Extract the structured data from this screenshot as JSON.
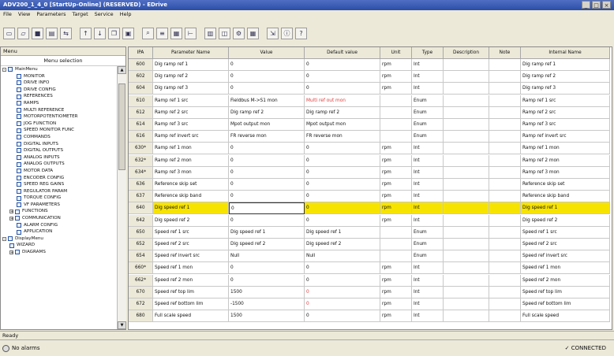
{
  "window": {
    "title": "ADV200_1_4_0 [StartUp-Online] (RESERVED) - EDrive",
    "controls": [
      "_",
      "□",
      "×"
    ]
  },
  "menubar": [
    "File",
    "View",
    "Parameters",
    "Target",
    "Service",
    "Help"
  ],
  "toolbar_icons": [
    "new-icon",
    "open-icon",
    "save-icon",
    "print-icon",
    "compare-icon",
    "upload-icon",
    "download-icon",
    "copy-icon",
    "paste-icon",
    "find-icon",
    "list-icon",
    "grid-icon",
    "tree-icon",
    "chart-icon",
    "monitor-icon",
    "param-icon",
    "table-icon",
    "export-icon",
    "info-icon",
    "help-icon"
  ],
  "sidebar": {
    "header": "Menu",
    "subheader": "Menu selection",
    "tree": [
      {
        "label": "MainMenu",
        "level": 0,
        "expand": "-"
      },
      {
        "label": "MONITOR",
        "level": 2
      },
      {
        "label": "DRIVE INFO",
        "level": 2
      },
      {
        "label": "DRIVE CONFIG",
        "level": 2
      },
      {
        "label": "REFERENCES",
        "level": 2
      },
      {
        "label": "RAMPS",
        "level": 2
      },
      {
        "label": "MULTI REFERENCE",
        "level": 2
      },
      {
        "label": "MOTORPOTENTIOMETER",
        "level": 2
      },
      {
        "label": "JOG FUNCTION",
        "level": 2
      },
      {
        "label": "SPEED MONITOR FUNC",
        "level": 2
      },
      {
        "label": "COMMANDS",
        "level": 2
      },
      {
        "label": "DIGITAL INPUTS",
        "level": 2
      },
      {
        "label": "DIGITAL OUTPUTS",
        "level": 2
      },
      {
        "label": "ANALOG INPUTS",
        "level": 2
      },
      {
        "label": "ANALOG OUTPUTS",
        "level": 2
      },
      {
        "label": "MOTOR DATA",
        "level": 2
      },
      {
        "label": "ENCODER CONFIG",
        "level": 2
      },
      {
        "label": "SPEED REG GAINS",
        "level": 2
      },
      {
        "label": "REGULATOR PARAM",
        "level": 2
      },
      {
        "label": "TORQUE CONFIG",
        "level": 2
      },
      {
        "label": "VF PARAMETERS",
        "level": 2
      },
      {
        "label": "FUNCTIONS",
        "level": 1,
        "expand": "+"
      },
      {
        "label": "COMMUNICATION",
        "level": 1,
        "expand": "+"
      },
      {
        "label": "ALARM CONFIG",
        "level": 2
      },
      {
        "label": "APPLICATION",
        "level": 2
      },
      {
        "label": "DisplayMenu",
        "level": 0,
        "expand": "-"
      },
      {
        "label": "WIZARD",
        "level": 1
      },
      {
        "label": "DIAGRAMS",
        "level": 1,
        "expand": "+"
      }
    ]
  },
  "table": {
    "columns": [
      "IPA",
      "Parameter Name",
      "Value",
      "Default value",
      "Unit",
      "Type",
      "Description",
      "Note",
      "Internal Name"
    ],
    "rows": [
      [
        "600",
        "Dig ramp ref 1",
        "0",
        "0",
        "rpm",
        "Int",
        "",
        "",
        "Dig ramp ref 1"
      ],
      [
        "602",
        "Dig ramp ref 2",
        "0",
        "0",
        "rpm",
        "Int",
        "",
        "",
        "Dig ramp ref 2"
      ],
      [
        "604",
        "Dig ramp ref 3",
        "0",
        "0",
        "rpm",
        "Int",
        "",
        "",
        "Dig ramp ref 3"
      ],
      [
        "610",
        "Ramp ref 1 src",
        "Fieldbus M->S1 mon",
        "Multi ref out mon",
        "",
        "Enum",
        "",
        "",
        "Ramp ref 1 src"
      ],
      [
        "612",
        "Ramp ref 2 src",
        "Dig ramp ref 2",
        "Dig ramp ref 2",
        "",
        "Enum",
        "",
        "",
        "Ramp ref 2 src"
      ],
      [
        "614",
        "Ramp ref 3 src",
        "Mpot output mon",
        "Mpot output mon",
        "",
        "Enum",
        "",
        "",
        "Ramp ref 3 src"
      ],
      [
        "616",
        "Ramp ref invert src",
        "FR reverse mon",
        "FR reverse mon",
        "",
        "Enum",
        "",
        "",
        "Ramp ref invert src"
      ],
      [
        "630*",
        "Ramp ref 1 mon",
        "0",
        "0",
        "rpm",
        "Int",
        "",
        "",
        "Ramp ref 1 mon"
      ],
      [
        "632*",
        "Ramp ref 2 mon",
        "0",
        "0",
        "rpm",
        "Int",
        "",
        "",
        "Ramp ref 2 mon"
      ],
      [
        "634*",
        "Ramp ref 3 mon",
        "0",
        "0",
        "rpm",
        "Int",
        "",
        "",
        "Ramp ref 3 mon"
      ],
      [
        "636",
        "Reference skip set",
        "0",
        "0",
        "rpm",
        "Int",
        "",
        "",
        "Reference skip set"
      ],
      [
        "637",
        "Reference skip band",
        "0",
        "0",
        "rpm",
        "Int",
        "",
        "",
        "Reference skip band"
      ],
      [
        "640",
        "Dig speed ref 1",
        "0",
        "0",
        "rpm",
        "Int",
        "",
        "",
        "Dig speed ref 1"
      ],
      [
        "642",
        "Dig speed ref 2",
        "0",
        "0",
        "rpm",
        "Int",
        "",
        "",
        "Dig speed ref 2"
      ],
      [
        "650",
        "Speed ref 1 src",
        "Dig speed ref 1",
        "Dig speed ref 1",
        "",
        "Enum",
        "",
        "",
        "Speed ref 1 src"
      ],
      [
        "652",
        "Speed ref 2 src",
        "Dig speed ref 2",
        "Dig speed ref 2",
        "",
        "Enum",
        "",
        "",
        "Speed ref 2 src"
      ],
      [
        "654",
        "Speed ref invert src",
        "Null",
        "Null",
        "",
        "Enum",
        "",
        "",
        "Speed ref invert src"
      ],
      [
        "660*",
        "Speed ref 1 mon",
        "0",
        "0",
        "rpm",
        "Int",
        "",
        "",
        "Speed ref 1 mon"
      ],
      [
        "662*",
        "Speed ref 2 mon",
        "0",
        "0",
        "rpm",
        "Int",
        "",
        "",
        "Speed ref 2 mon"
      ],
      [
        "670",
        "Speed ref top lim",
        "1500",
        "0",
        "rpm",
        "Int",
        "",
        "",
        "Speed ref top lim"
      ],
      [
        "672",
        "Speed ref bottom lim",
        "-1500",
        "0",
        "rpm",
        "Int",
        "",
        "",
        "Speed ref bottom lim"
      ],
      [
        "680",
        "Full scale speed",
        "1500",
        "0",
        "rpm",
        "Int",
        "",
        "",
        "Full scale speed"
      ]
    ],
    "selected_row": 12,
    "red_default_rows": [
      3,
      19,
      20
    ]
  },
  "status": {
    "line1": "Ready",
    "alarms": "No alarms",
    "connection": "CONNECTED"
  }
}
